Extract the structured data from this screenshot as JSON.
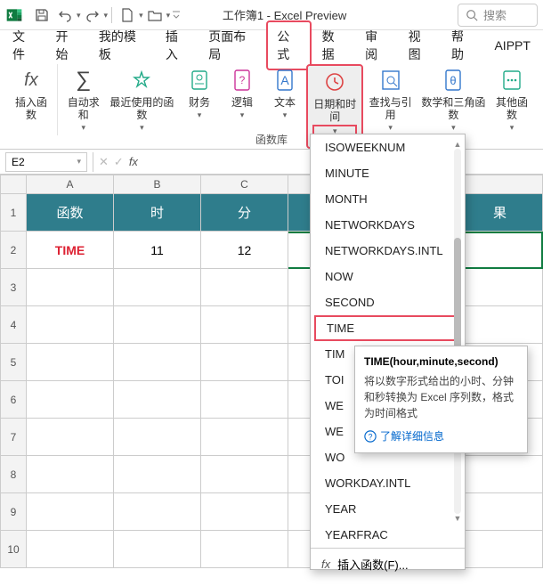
{
  "title": "工作簿1  -  Excel Preview",
  "search_placeholder": "搜索",
  "tabs": [
    "文件",
    "开始",
    "我的模板",
    "插入",
    "页面布局",
    "公式",
    "数据",
    "审阅",
    "视图",
    "帮助",
    "AIPPT"
  ],
  "active_tab_index": 5,
  "ribbon": {
    "insert_fn": "插入函数",
    "autosum": "自动求和",
    "recent": "最近使用的函数",
    "financial": "财务",
    "logical": "逻辑",
    "text": "文本",
    "datetime": "日期和时间",
    "lookup": "查找与引用",
    "math": "数学和三角函数",
    "more": "其他函数",
    "group_label": "函数库"
  },
  "namebox_value": "E2",
  "columns": [
    "A",
    "B",
    "C"
  ],
  "header_cells": [
    "函数",
    "时",
    "分"
  ],
  "result_header": "果",
  "row2": {
    "fn": "TIME",
    "h": "11",
    "m": "12"
  },
  "row_numbers": [
    "1",
    "2",
    "3",
    "4",
    "5",
    "6",
    "7",
    "8",
    "9",
    "10"
  ],
  "dropdown_items": [
    "ISOWEEKNUM",
    "MINUTE",
    "MONTH",
    "NETWORKDAYS",
    "NETWORKDAYS.INTL",
    "NOW",
    "SECOND",
    "TIME",
    "TIM",
    "TOI",
    "WE",
    "WE",
    "WO",
    "WORKDAY.INTL",
    "YEAR",
    "YEARFRAC"
  ],
  "dropdown_highlight_index": 7,
  "dropdown_footer": "插入函数(F)...",
  "tooltip": {
    "title": "TIME(hour,minute,second)",
    "body": "将以数字形式给出的小时、分钟和秒转换为 Excel 序列数，格式为时间格式",
    "link": "了解详细信息"
  },
  "colors": {
    "highlight": "#e84a5f",
    "teal": "#2f7d8c"
  },
  "chart_data": null
}
